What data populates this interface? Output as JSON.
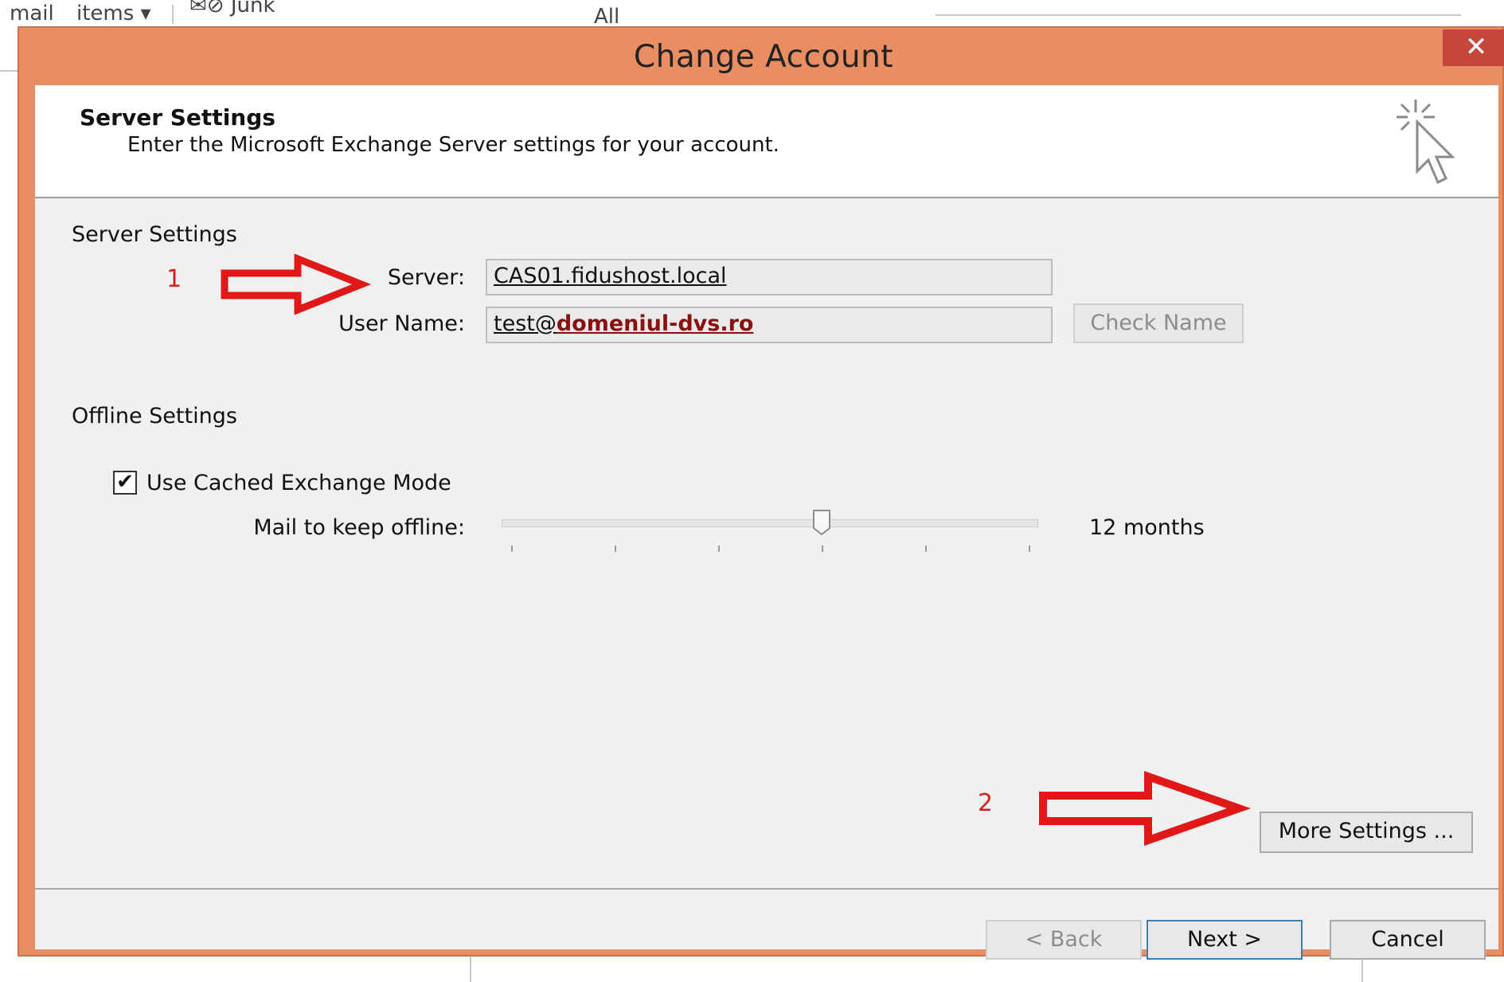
{
  "background": {
    "items": [
      "mail",
      "items ▾",
      "✉⊘ Junk",
      "All"
    ]
  },
  "dialog": {
    "title": "Change Account",
    "close_label": "✕",
    "header": {
      "title": "Server Settings",
      "subtitle": "Enter the Microsoft Exchange Server settings for your account."
    },
    "server_section": {
      "heading": "Server Settings",
      "server_label": "Server:",
      "server_value": "CAS01.fidushost.local",
      "username_label": "User Name:",
      "username_prefix": "test@",
      "username_domain": "domeniul-dvs.ro",
      "check_name_label": "Check Name"
    },
    "offline_section": {
      "heading": "Offline Settings",
      "cached_mode_label": "Use Cached Exchange Mode",
      "cached_mode_checked": true,
      "keep_offline_label": "Mail to keep offline:",
      "keep_offline_value": "12 months",
      "slider_position": 0.6,
      "slider_ticks": 6
    },
    "annotations": {
      "first": "1",
      "second": "2"
    },
    "more_settings_label": "More Settings ...",
    "footer": {
      "back_label": "< Back",
      "next_label": "Next >",
      "cancel_label": "Cancel"
    }
  },
  "colors": {
    "frame": "#e98e63",
    "close": "#c4473a",
    "annotation": "#d42020",
    "default_button_border": "#3c7fb1"
  }
}
